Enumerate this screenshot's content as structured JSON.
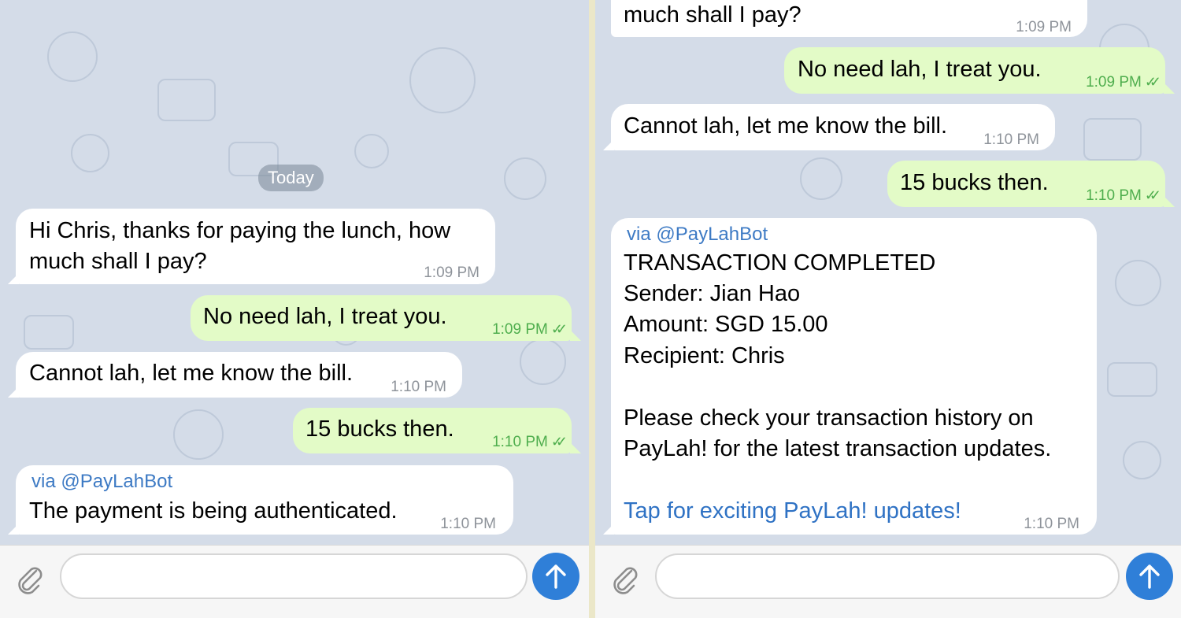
{
  "left_panel": {
    "date_label": "Today",
    "messages": [
      {
        "direction": "in",
        "lines": [
          "Hi Chris, thanks for paying the lunch, how",
          "much shall I pay?"
        ],
        "time": "1:09 PM"
      },
      {
        "direction": "out",
        "lines": [
          "No need lah, I treat you."
        ],
        "time": "1:09 PM"
      },
      {
        "direction": "in",
        "lines": [
          "Cannot lah, let me know the bill."
        ],
        "time": "1:10 PM"
      },
      {
        "direction": "out",
        "lines": [
          "15 bucks then."
        ],
        "time": "1:10 PM"
      },
      {
        "direction": "in",
        "via": "via @PayLahBot",
        "lines": [
          "The payment is being authenticated."
        ],
        "time": "1:10 PM"
      }
    ]
  },
  "right_panel": {
    "messages": [
      {
        "direction": "in",
        "lines": [
          "much shall I pay?"
        ],
        "time": "1:09 PM"
      },
      {
        "direction": "out",
        "lines": [
          "No need lah, I treat you."
        ],
        "time": "1:09 PM"
      },
      {
        "direction": "in",
        "lines": [
          "Cannot lah, let me know the bill."
        ],
        "time": "1:10 PM"
      },
      {
        "direction": "out",
        "lines": [
          "15 bucks then."
        ],
        "time": "1:10 PM"
      },
      {
        "direction": "in",
        "via": "via @PayLahBot",
        "lines": [
          "TRANSACTION COMPLETED",
          "Sender: Jian Hao",
          "Amount: SGD 15.00",
          "Recipient: Chris",
          "",
          "Please check your transaction history on",
          "PayLah! for the latest transaction updates.",
          ""
        ],
        "link": "Tap for exciting PayLah! updates!",
        "time": "1:10 PM"
      }
    ]
  },
  "composer": {
    "attach_icon": "paperclip-icon",
    "send_icon": "arrow-up-icon",
    "message_value": ""
  },
  "colors": {
    "incoming": "#ffffff",
    "outgoing": "#e3fbc7",
    "send_button": "#2f7fd8",
    "link": "#2f72c4"
  }
}
